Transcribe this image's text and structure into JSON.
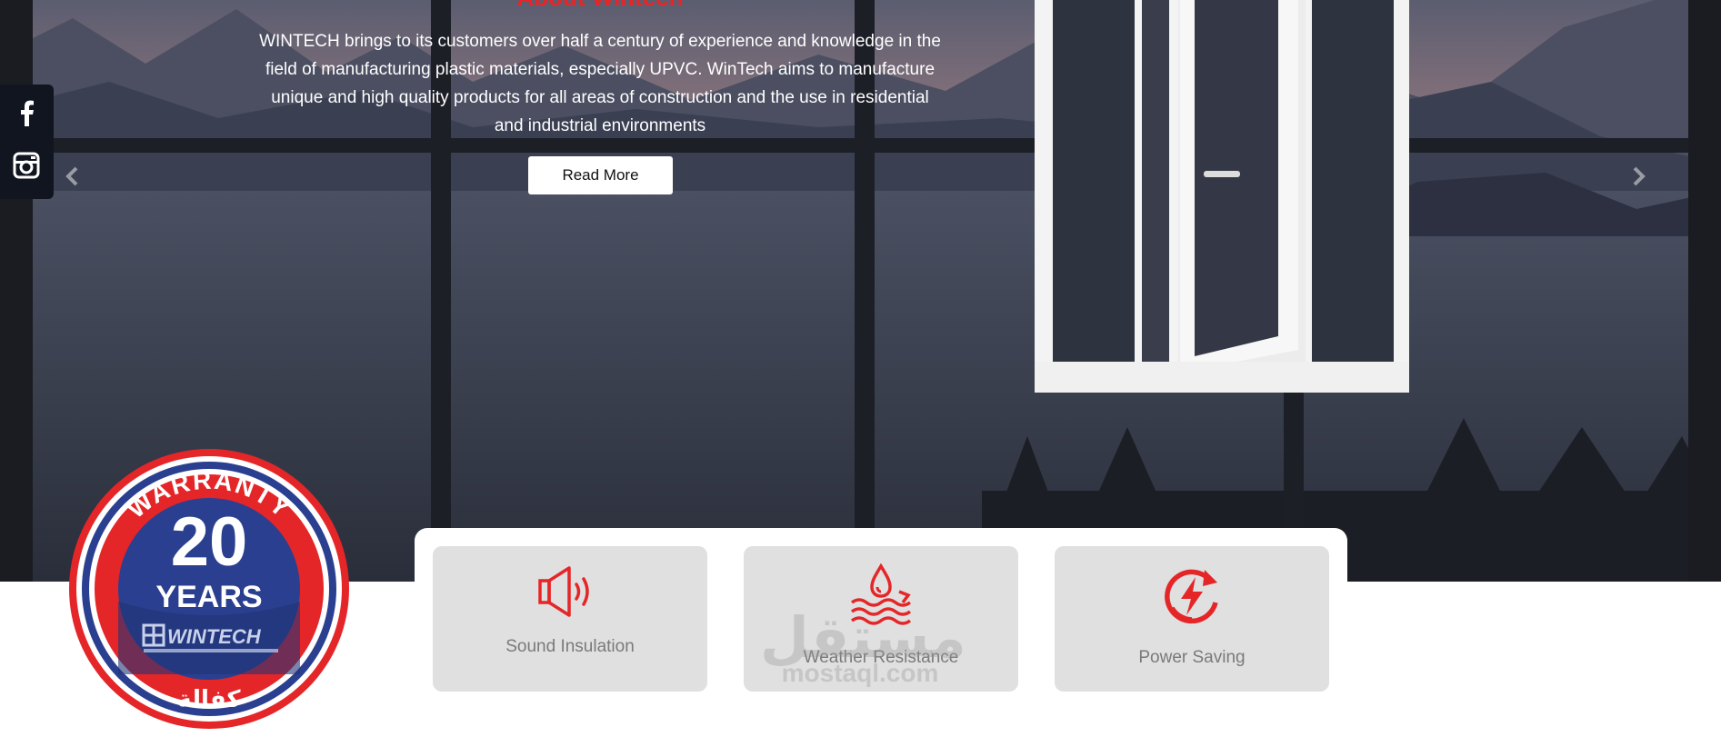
{
  "hero": {
    "title": "About Wintech",
    "description": "WINTECH brings to its customers over half a century of experience and knowledge in the field of manufacturing plastic materials, especially UPVC. WinTech aims to manufacture unique and high quality products for all areas of construction and the use in residential and industrial environments",
    "read_more_label": "Read More",
    "prev_icon": "chevron-left-icon",
    "next_icon": "chevron-right-icon"
  },
  "social": {
    "items": [
      {
        "icon": "facebook-icon",
        "label": "f"
      },
      {
        "icon": "instagram-icon"
      }
    ]
  },
  "features": [
    {
      "icon": "speaker-icon",
      "label": "Sound Insulation"
    },
    {
      "icon": "water-drop-waves-icon",
      "label": "Weather Resistance"
    },
    {
      "icon": "power-cycle-icon",
      "label": "Power Saving"
    }
  ],
  "badge": {
    "top_text": "WARRANTY",
    "number": "20",
    "unit": "YEARS",
    "brand": "WINTECH",
    "arabic": "كفالة"
  },
  "watermark": {
    "arabic": "مستقل",
    "latin": "mostaql.com"
  },
  "colors": {
    "accent_red": "#e52628",
    "badge_blue": "#2a3f8f",
    "card_bg": "#e0e0e0",
    "social_bg": "#101520"
  }
}
